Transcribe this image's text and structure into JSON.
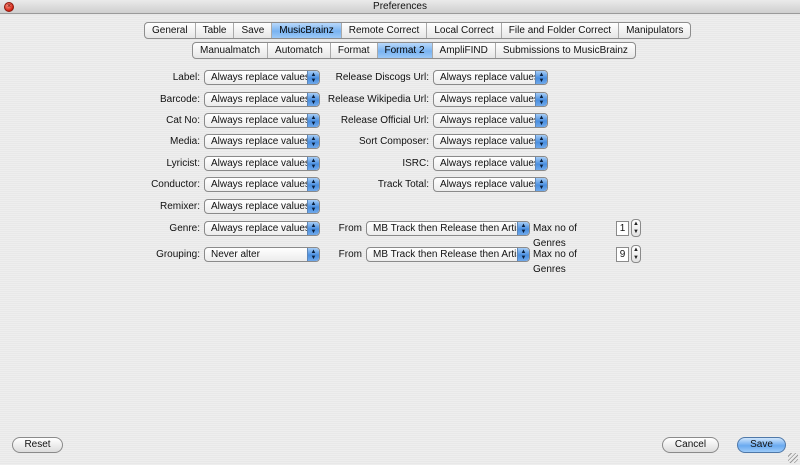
{
  "window": {
    "title": "Preferences"
  },
  "main_tabs": [
    {
      "label": "General",
      "active": false
    },
    {
      "label": "Table",
      "active": false
    },
    {
      "label": "Save",
      "active": false
    },
    {
      "label": "MusicBrainz",
      "active": true
    },
    {
      "label": "Remote Correct",
      "active": false
    },
    {
      "label": "Local Correct",
      "active": false
    },
    {
      "label": "File and Folder Correct",
      "active": false
    },
    {
      "label": "Manipulators",
      "active": false
    }
  ],
  "sub_tabs": [
    {
      "label": "Manualmatch",
      "active": false
    },
    {
      "label": "Automatch",
      "active": false
    },
    {
      "label": "Format",
      "active": false
    },
    {
      "label": "Format 2",
      "active": true
    },
    {
      "label": "AmpliFIND",
      "active": false
    },
    {
      "label": "Submissions to MusicBrainz",
      "active": false
    }
  ],
  "left_fields": [
    {
      "label": "Label:",
      "value": "Always replace values"
    },
    {
      "label": "Barcode:",
      "value": "Always replace values"
    },
    {
      "label": "Cat No:",
      "value": "Always replace values"
    },
    {
      "label": "Media:",
      "value": "Always replace values"
    },
    {
      "label": "Lyricist:",
      "value": "Always replace values"
    },
    {
      "label": "Conductor:",
      "value": "Always replace values"
    },
    {
      "label": "Remixer:",
      "value": "Always replace values"
    },
    {
      "label": "Genre:",
      "value": "Always replace values"
    },
    {
      "label": "Grouping:",
      "value": "Never alter"
    }
  ],
  "right_fields": [
    {
      "label": "Release Discogs Url:",
      "value": "Always replace values"
    },
    {
      "label": "Release Wikipedia Url:",
      "value": "Always replace values"
    },
    {
      "label": "Release Official Url:",
      "value": "Always replace values"
    },
    {
      "label": "Sort Composer:",
      "value": "Always replace values"
    },
    {
      "label": "ISRC:",
      "value": "Always replace values"
    },
    {
      "label": "Track Total:",
      "value": "Always replace values"
    }
  ],
  "genre_row": {
    "from_label": "From",
    "from_value": "MB Track then Release then Artist",
    "max_label": "Max no of Genres",
    "max_value": "1"
  },
  "grouping_row": {
    "from_label": "From",
    "from_value": "MB Track then Release then Artist",
    "max_label": "Max no of Genres",
    "max_value": "9"
  },
  "buttons": {
    "reset": "Reset",
    "cancel": "Cancel",
    "save": "Save"
  },
  "icons": {
    "close": "close-icon",
    "select_arrows": "updown-arrows-icon",
    "stepper": "stepper-arrows-icon",
    "resize": "resize-grip-icon"
  }
}
